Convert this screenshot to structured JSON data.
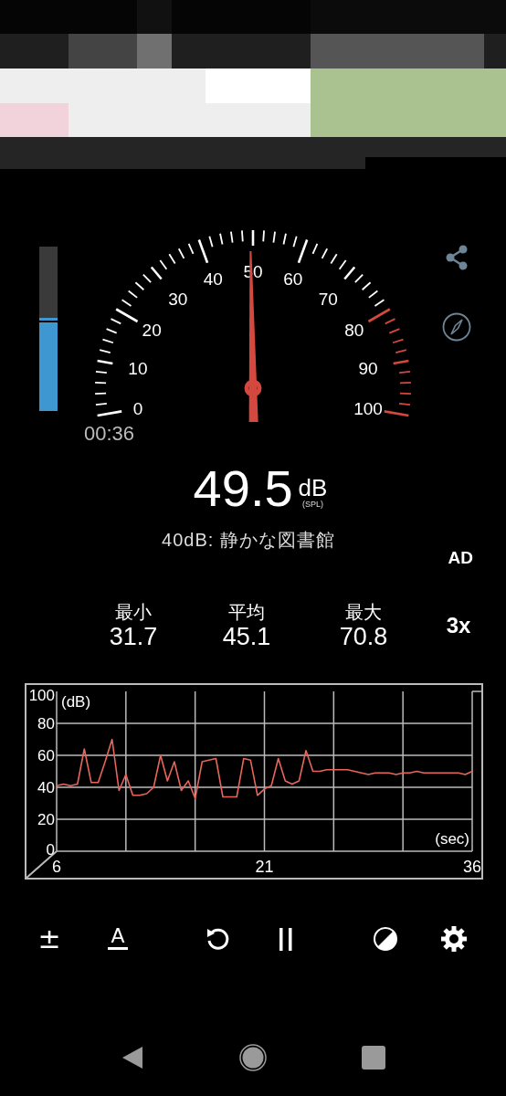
{
  "level_meter": {
    "level": 0.55
  },
  "gauge": {
    "labels": [
      "0",
      "10",
      "20",
      "30",
      "40",
      "50",
      "60",
      "70",
      "80",
      "90",
      "100"
    ]
  },
  "timer": "00:36",
  "reading": {
    "value": "49.5",
    "unit": "dB",
    "weighting": "(SPL)"
  },
  "description": "40dB: 静かな図書館",
  "ad_label": "AD",
  "stats": [
    {
      "label": "最小",
      "value": "31.7"
    },
    {
      "label": "平均",
      "value": "45.1"
    },
    {
      "label": "最大",
      "value": "70.8"
    }
  ],
  "zoom_label": "3x",
  "chart_data": {
    "type": "line",
    "xlabel": "(sec)",
    "ylabel": "(dB)",
    "grid": true,
    "xlim": [
      6,
      36
    ],
    "ylim": [
      0,
      100
    ],
    "xticks": [
      6,
      21,
      36
    ],
    "yticks": [
      0,
      20,
      40,
      60,
      80,
      100
    ],
    "x": [
      6,
      6.5,
      7,
      7.5,
      8,
      8.5,
      9,
      9.5,
      10,
      10.5,
      11,
      11.5,
      12,
      12.5,
      13,
      13.5,
      14,
      14.5,
      15,
      15.5,
      16,
      16.5,
      17,
      17.5,
      18,
      18.5,
      19,
      19.5,
      20,
      20.5,
      21,
      21.5,
      22,
      22.5,
      23,
      23.5,
      24,
      24.5,
      25,
      25.5,
      26,
      26.5,
      27,
      27.5,
      28,
      28.5,
      29,
      29.5,
      30,
      30.5,
      31,
      31.5,
      32,
      32.5,
      33,
      33.5,
      34,
      34.5,
      35,
      35.5,
      36
    ],
    "series": [
      {
        "color": "#e8655b",
        "values": [
          41,
          42,
          41,
          42,
          64,
          43,
          43,
          56,
          70,
          38,
          48,
          35,
          35,
          36,
          40,
          60,
          44,
          56,
          38,
          44,
          33,
          56,
          57,
          58,
          34,
          34,
          34,
          58,
          57,
          35,
          39,
          41,
          58,
          44,
          42,
          44,
          63,
          50,
          50,
          51,
          51,
          51,
          51,
          50,
          49,
          48,
          49,
          49,
          49,
          48,
          49,
          49,
          50,
          49,
          49,
          49,
          49,
          49,
          49,
          48,
          50
        ]
      }
    ]
  },
  "toolbar": [
    {
      "kind": "text",
      "label": "±"
    },
    {
      "kind": "underlined",
      "label": "A"
    },
    {
      "kind": "reset"
    },
    {
      "kind": "pause"
    },
    {
      "kind": "contrast"
    },
    {
      "kind": "settings"
    }
  ],
  "nav_bar": [
    {
      "kind": "back"
    },
    {
      "kind": "home"
    },
    {
      "kind": "recents"
    }
  ]
}
